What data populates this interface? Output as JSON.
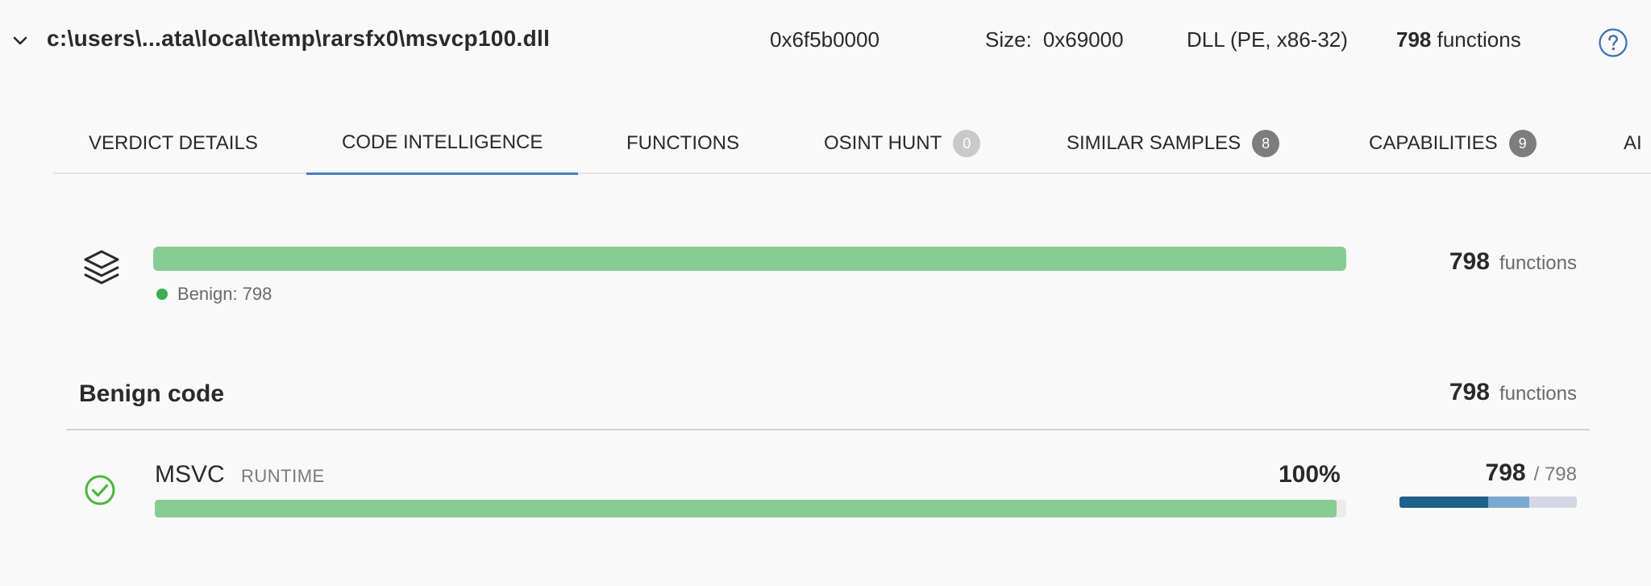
{
  "header": {
    "file_path": "c:\\users\\...ata\\local\\temp\\rarsfx0\\msvcp100.dll",
    "address": "0x6f5b0000",
    "size_label": "Size:",
    "size_value": "0x69000",
    "file_type": "DLL (PE, x86-32)",
    "functions_count": "798",
    "functions_unit": "functions",
    "chevron_icon": "chevron-down-icon",
    "help_icon": "help-circle-icon"
  },
  "tabs": [
    {
      "label": "VERDICT DETAILS",
      "badge": null,
      "active": false
    },
    {
      "label": "CODE INTELLIGENCE",
      "badge": null,
      "active": true
    },
    {
      "label": "FUNCTIONS",
      "badge": null,
      "active": false
    },
    {
      "label": "OSINT HUNT",
      "badge": "0",
      "active": false
    },
    {
      "label": "SIMILAR SAMPLES",
      "badge": "8",
      "active": false
    },
    {
      "label": "CAPABILITIES",
      "badge": "9",
      "active": false
    },
    {
      "label": "AI",
      "badge": null,
      "active": false
    }
  ],
  "summary": {
    "icon": "layers-icon",
    "benign_fraction": 1.0,
    "legend_label": "Benign:",
    "legend_count": "798",
    "functions_count": "798",
    "functions_unit": "functions",
    "accent_color": "#88cc94"
  },
  "section": {
    "title": "Benign code",
    "functions_count": "798",
    "functions_unit": "functions"
  },
  "rows": [
    {
      "name": "MSVC",
      "tag": "RUNTIME",
      "percent": "100%",
      "fill_fraction": 0.992,
      "count": "798",
      "total": "/ 798",
      "status_icon": "check-circle-icon",
      "breakdown_fractions": [
        0.5,
        0.23,
        0.27
      ]
    }
  ]
}
